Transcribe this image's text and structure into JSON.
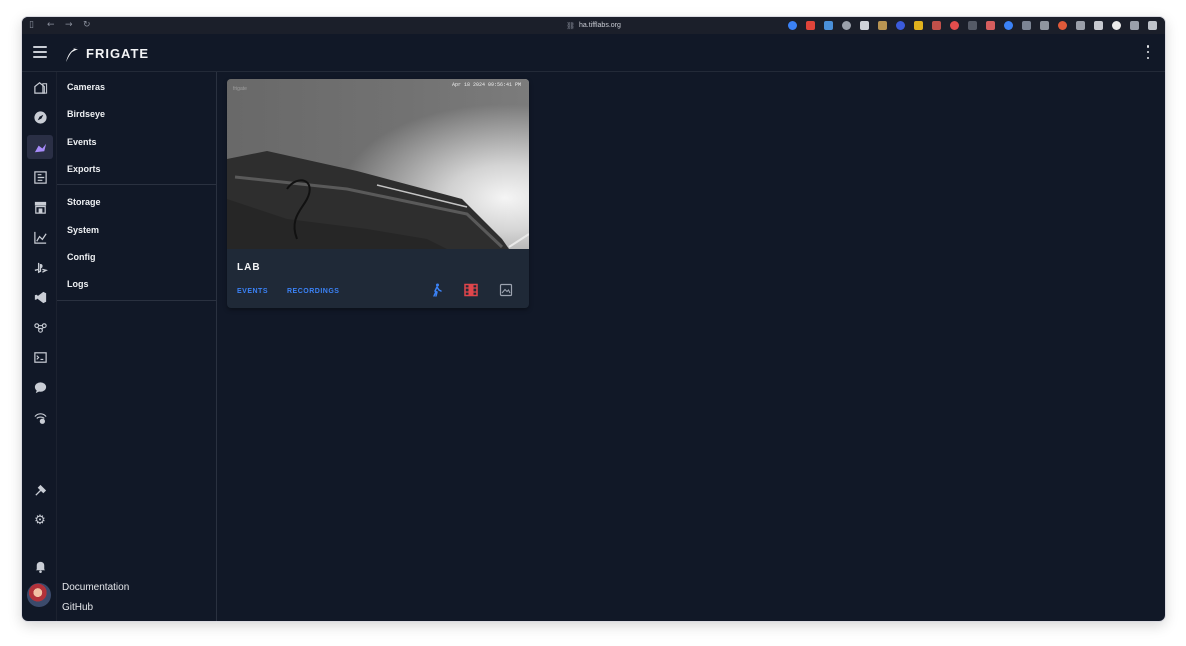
{
  "browser": {
    "url": "ha.tifflabs.org",
    "extension_colors": [
      "#3b82f6",
      "#e0443a",
      "#4a90d9",
      "#9aa0ab",
      "#cfd3da",
      "#b89452",
      "#3b5bdb",
      "#e0b21d",
      "#c0504a",
      "#e24d4d",
      "#555a66",
      "#d65e5e",
      "#3b82f6",
      "#7b8494",
      "#8f959f",
      "#e05a3a",
      "#9a9fa9",
      "#c6c9cf",
      "#eaeaea",
      "#9aa0ab",
      "#bfc3ca"
    ]
  },
  "header": {
    "app_name": "FRIGATE"
  },
  "subnav": {
    "group1": [
      "Cameras",
      "Birdseye",
      "Events",
      "Exports"
    ],
    "group2": [
      "Storage",
      "System",
      "Config",
      "Logs"
    ],
    "footer": [
      "Documentation",
      "GitHub"
    ]
  },
  "camera": {
    "name": "LAB",
    "timestamp": "Apr 18 2024  09:56:41 PM",
    "overlay_logo": "frigate",
    "events_label": "EVENTS",
    "recordings_label": "RECORDINGS",
    "detect_color": "#3b82f6",
    "recordings_icon_color": "#e0454b",
    "snapshots_icon_color": "#9ca3af"
  },
  "theme": {
    "background": "#111827",
    "card": "#1f2937",
    "accent": "#3b82f6",
    "active_rail": "#a78bfa"
  }
}
